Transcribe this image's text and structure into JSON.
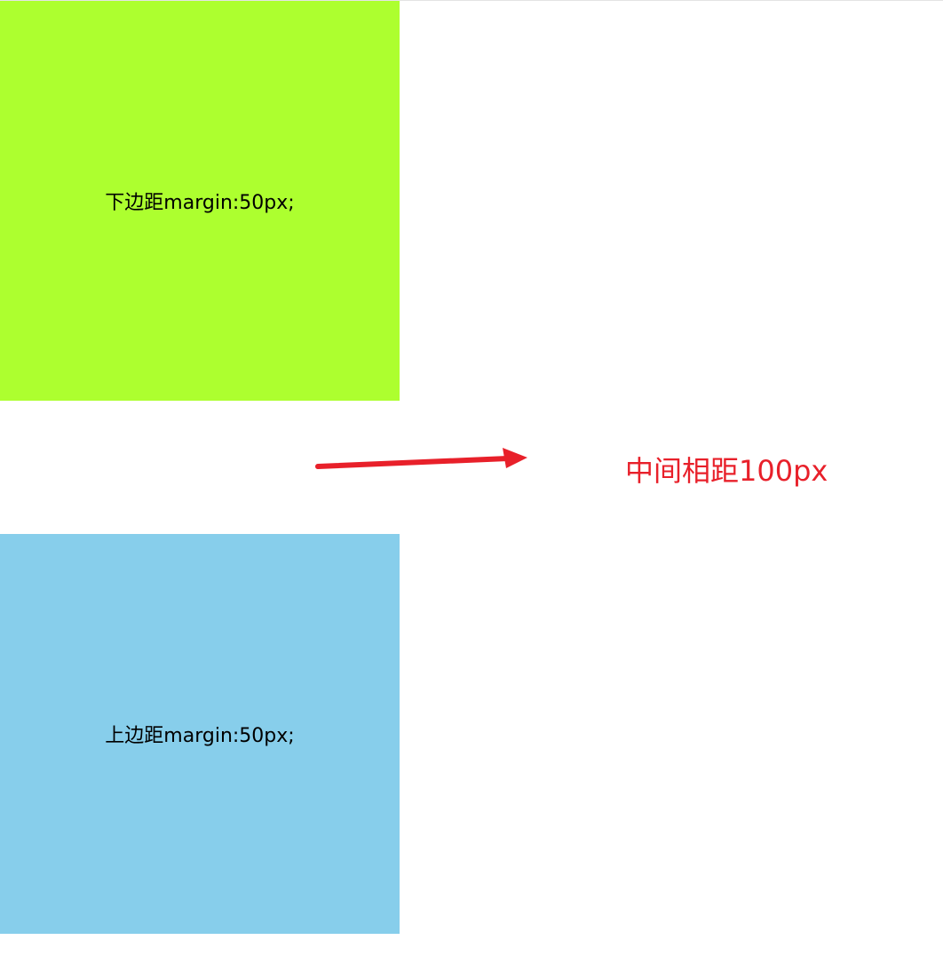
{
  "boxes": {
    "top": {
      "label": "下边距margin:50px;",
      "color": "#adff2f"
    },
    "bottom": {
      "label": "上边距margin:50px;",
      "color": "#87ceeb"
    }
  },
  "annotation": {
    "text": "中间相距100px",
    "color": "#e8202a",
    "icon": "right-arrow-icon"
  }
}
